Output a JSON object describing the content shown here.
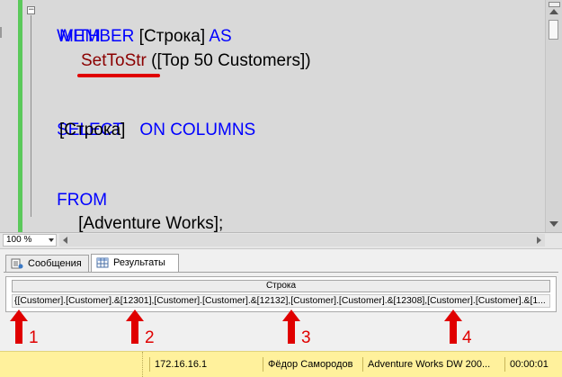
{
  "editor": {
    "lines": {
      "l1_kw": "WITH",
      "l2_kw": "MEMBER",
      "l2_rest": " [Строка] ",
      "l2_kw2": "AS",
      "l3_fn": "SetToStr",
      "l3_rest": " ([Top 50 Customers])",
      "l4_kw": "SELECT",
      "l5_text": "[Строка]",
      "l5_kw": "ON COLUMNS",
      "l6_kw": "FROM",
      "l7_text": "[Adventure Works];"
    },
    "collapse_symbol": "−"
  },
  "zoom": {
    "value": "100 %"
  },
  "results": {
    "tabs": [
      {
        "label": "Сообщения",
        "active": false
      },
      {
        "label": "Результаты",
        "active": true
      }
    ],
    "grid": {
      "column_header": "Строка",
      "cell_value": "{[Customer].[Customer].&[12301],[Customer].[Customer].&[12132],[Customer].[Customer].&[12308],[Customer].[Customer].&[1..."
    }
  },
  "annotations": {
    "markers": [
      "1",
      "2",
      "3",
      "4"
    ],
    "color": "#e00000"
  },
  "status_bar": {
    "server": "172.16.16.1",
    "user": "Фёдор Самородов",
    "database": "Adventure Works DW 200...",
    "elapsed": "00:00:01"
  },
  "colors": {
    "keyword": "#0000ff",
    "function": "#8b0000",
    "status_bar_bg": "#fff19c",
    "editor_bg": "#d9d9d9"
  }
}
